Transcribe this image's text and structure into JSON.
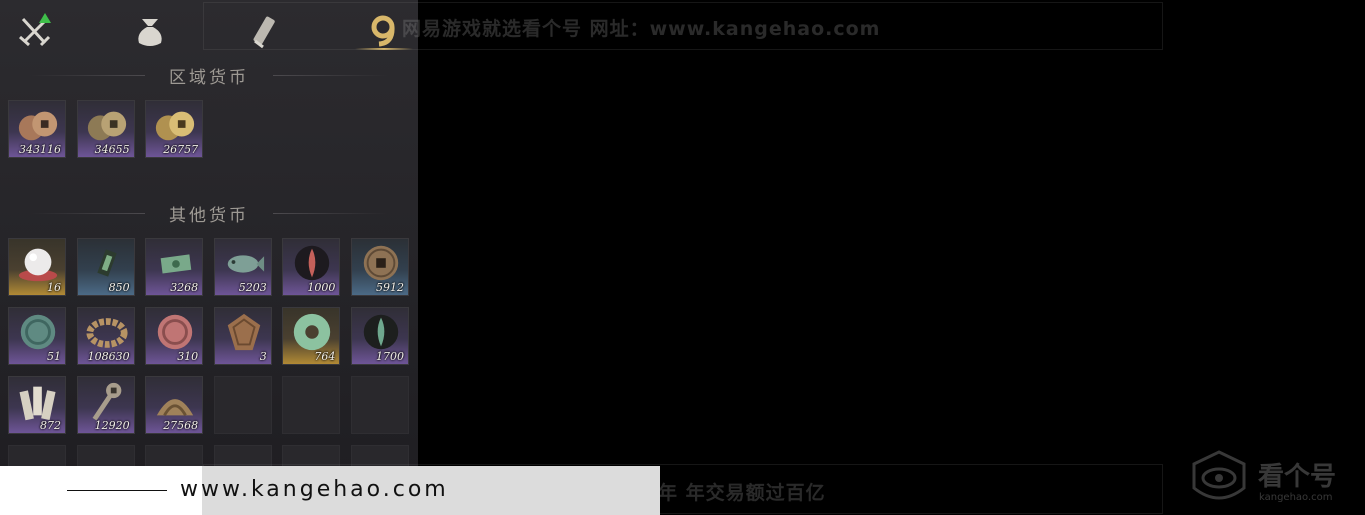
{
  "tabs": [
    {
      "id": "equipment",
      "icon": "crossed-swords-icon",
      "badge": "green-triangle"
    },
    {
      "id": "bag",
      "icon": "cloth-bag-icon"
    },
    {
      "id": "scroll",
      "icon": "scroll-icon"
    },
    {
      "id": "currency",
      "icon": "currency-coin-icon",
      "active": true
    }
  ],
  "sections": {
    "regional": {
      "title": "区域货币",
      "items": [
        {
          "icon": "copper-coins-icon",
          "rarity": "purple",
          "qty": "343116"
        },
        {
          "icon": "bronze-coins-icon",
          "rarity": "purple",
          "qty": "34655"
        },
        {
          "icon": "gold-coins-icon",
          "rarity": "purple",
          "qty": "26757"
        }
      ]
    },
    "other": {
      "title": "其他货币",
      "items": [
        {
          "icon": "pearl-icon",
          "rarity": "gold",
          "qty": "16"
        },
        {
          "icon": "jade-talisman-icon",
          "rarity": "blue",
          "qty": "850"
        },
        {
          "icon": "green-note-icon",
          "rarity": "purple",
          "qty": "3268"
        },
        {
          "icon": "jade-fish-icon",
          "rarity": "purple",
          "qty": "5203"
        },
        {
          "icon": "red-flame-icon",
          "rarity": "purple",
          "qty": "1000"
        },
        {
          "icon": "square-hole-coin-icon",
          "rarity": "blue",
          "qty": "5912"
        },
        {
          "icon": "green-medallion-icon",
          "rarity": "purple",
          "qty": "51"
        },
        {
          "icon": "bead-bracelet-icon",
          "rarity": "purple",
          "qty": "108630"
        },
        {
          "icon": "red-medallion-icon",
          "rarity": "purple",
          "qty": "310"
        },
        {
          "icon": "engraved-plaque-icon",
          "rarity": "purple",
          "qty": "3"
        },
        {
          "icon": "jade-disc-icon",
          "rarity": "gold",
          "qty": "764"
        },
        {
          "icon": "green-flame-icon",
          "rarity": "purple",
          "qty": "1700"
        },
        {
          "icon": "bamboo-slips-icon",
          "rarity": "purple",
          "qty": "872"
        },
        {
          "icon": "coin-sword-icon",
          "rarity": "purple",
          "qty": "12920"
        },
        {
          "icon": "bronze-fan-icon",
          "rarity": "purple",
          "qty": "27568"
        }
      ]
    }
  },
  "watermark": {
    "top_text": "网易游戏就选看个号    网址：www.kangehao.com",
    "bottom_text": "看个号专业网易游戏八年    年交易额过百亿",
    "footer_url": "www.kangehao.com",
    "logo_text": "看个号",
    "logo_sub": "kangehao.com"
  },
  "colors": {
    "accent_gold": "#d8b76a",
    "rarity_purple": "#6e5597",
    "rarity_gold": "#b18a35",
    "rarity_blue": "#4b6a86",
    "tab_badge": "#3fbf4a"
  }
}
